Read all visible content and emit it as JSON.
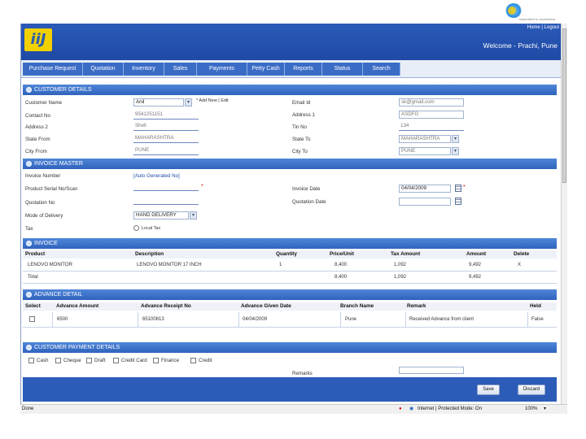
{
  "brand": {
    "tagline": "committed to excellence",
    "letter": "b"
  },
  "header": {
    "logo": "iiJ",
    "links": [
      "Home",
      "Logout"
    ],
    "welcome": "Welcome - Prachi, Pune"
  },
  "nav": [
    "Purchase Request",
    "Quotation",
    "Inventory",
    "Sales",
    "Payments",
    "Petty Cash",
    "Reports",
    "Status",
    "Search"
  ],
  "customer": {
    "title": "CUSTOMER DETAILS",
    "customer_name_label": "Customer Name",
    "customer_name_value": "Anil",
    "add_new": "* Add New",
    "add_new_sep": "|",
    "edit": "Edit",
    "contact_label": "Contact No",
    "contact_value": "9541251151",
    "address2_label": "Address 2",
    "address2_value": "Shell",
    "state_from_label": "State From",
    "state_from_value": "MAHARASHTRA",
    "city_from_label": "City From",
    "city_from_value": "PUNE",
    "email_label": "Email Id",
    "email_value": "sk@gmail.com",
    "address1_label": "Address 1",
    "address1_value": "ASDFG",
    "tin_label": "Tin No",
    "tin_value": "134",
    "state_to_label": "State To",
    "state_to_value": "MAHARASHTRA",
    "city_to_label": "City To",
    "city_to_value": "PUNE"
  },
  "invoice_master": {
    "title": "INVOICE MASTER",
    "invoice_number_label": "Invoice Number",
    "invoice_number_value": "[Auto Generated No]",
    "serial_label": "Product Serial No/Scan",
    "invoice_date_label": "Invoice Date",
    "invoice_date_value": "04/04/2009",
    "quotation_no_label": "Quotation No",
    "quotation_date_label": "Quotation Date",
    "delivery_label": "Mode of Delivery",
    "delivery_value": "HAND DELIVERY",
    "tax_label": "Tax",
    "tax_option": "Local Tax"
  },
  "invoice": {
    "title": "INVOICE",
    "headers": [
      "Product",
      "Description",
      "Quantity",
      "Price/Unit",
      "Tax Amount",
      "Amount",
      "Delete"
    ],
    "rows": [
      [
        "LENOVO MONITOR",
        "LENOVO MONITOR 17 INCH",
        "1",
        "8,400",
        "1,092",
        "9,492",
        "X"
      ]
    ],
    "total": [
      "Total",
      "8,400",
      "1,092",
      "9,492"
    ]
  },
  "advance": {
    "title": "ADVANCE DETAIL",
    "headers": [
      "Select",
      "Advance Amount",
      "Advance Receipt No",
      "Advance Given Date",
      "Branch Name",
      "Remark",
      "Held"
    ],
    "rows": [
      [
        "",
        "6500",
        "65100813",
        "04/04/2009",
        "Pune",
        "Received Advance from client",
        "False"
      ]
    ]
  },
  "payment": {
    "title": "CUSTOMER PAYMENT DETAILS",
    "options": [
      "Cash",
      "Cheque",
      "Draft",
      "Credit Card",
      "Finance",
      "Credit"
    ],
    "remarks_label": "Remarks"
  },
  "actions": {
    "save": "Save",
    "discard": "Discard"
  },
  "status_bar": {
    "left": "Done",
    "zone": "Internet | Protected Mode: On",
    "zoom": "100%"
  }
}
